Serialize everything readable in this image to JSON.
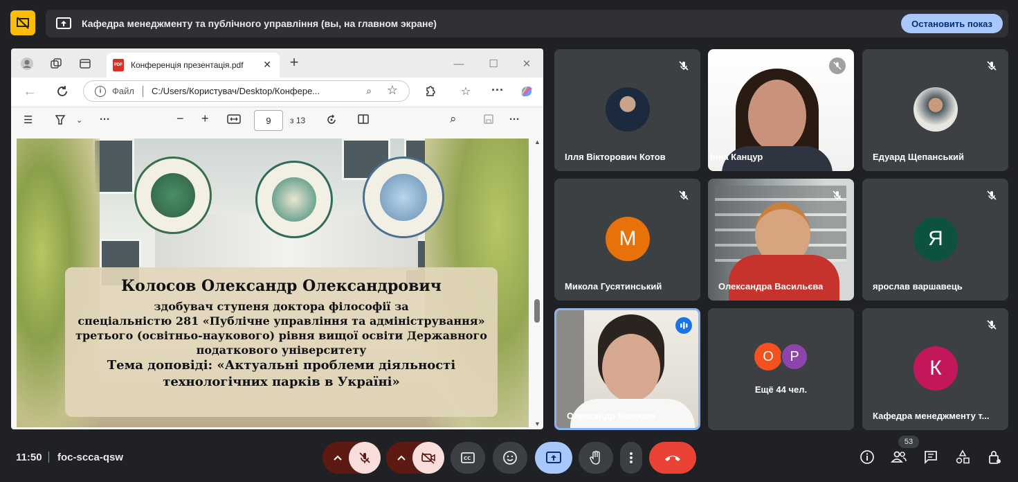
{
  "banner": {
    "title": "Кафедра менеджменту та публічного управління (вы, на главном экране)",
    "stop_button": "Остановить показ"
  },
  "browser": {
    "tab_title": "Конференція презентація.pdf",
    "address_label": "Файл",
    "address_path": "C:/Users/Користувач/Desktop/Конфере...",
    "page_number": "9",
    "page_total": "з 13"
  },
  "slide": {
    "name": "Колосов Олександр Олександрович",
    "lines": [
      "здобувач ступеня доктора філософії за",
      "спеціальністю 281 «Публічне управління та адміністрування»",
      "третього (освітньо-наукового) рівня вищої освіти Державного",
      "податкового університету"
    ],
    "topic": [
      "Тема доповіді: «Актуальні проблеми діяльності",
      "технологічних парків в Україні»"
    ]
  },
  "participants": [
    {
      "name": "Ілля Вікторович Котов",
      "muted": true
    },
    {
      "name": "Інна Канцур",
      "muted": true
    },
    {
      "name": "Едуард Щепанський",
      "muted": true
    },
    {
      "name": "Микола Гусятинський",
      "initial": "М",
      "color": "#e8710a",
      "muted": true
    },
    {
      "name": "Олександра Васильєва",
      "muted": true
    },
    {
      "name": "ярослав варшавець",
      "initial": "Я",
      "color": "#0d5240",
      "muted": true
    },
    {
      "name": "Олександр Колосов",
      "speaking": true
    },
    {
      "others_label": "Ещё 44 чел.",
      "initials": [
        "О",
        "Р"
      ],
      "colors": [
        "#f4511e",
        "#8e44ad"
      ]
    },
    {
      "name": "Кафедра менеджменту т...",
      "initial": "К",
      "color": "#c2185b",
      "muted": true
    }
  ],
  "meeting": {
    "time": "11:50",
    "code": "foc-scca-qsw",
    "participant_count": "53"
  },
  "colors": {
    "background": "#202124",
    "tile": "#3c4043",
    "accent_blue": "#a8c7fa",
    "end_call": "#ea4335",
    "muted_control": "#f9dedc",
    "highlight_yellow": "#fbbc04"
  }
}
